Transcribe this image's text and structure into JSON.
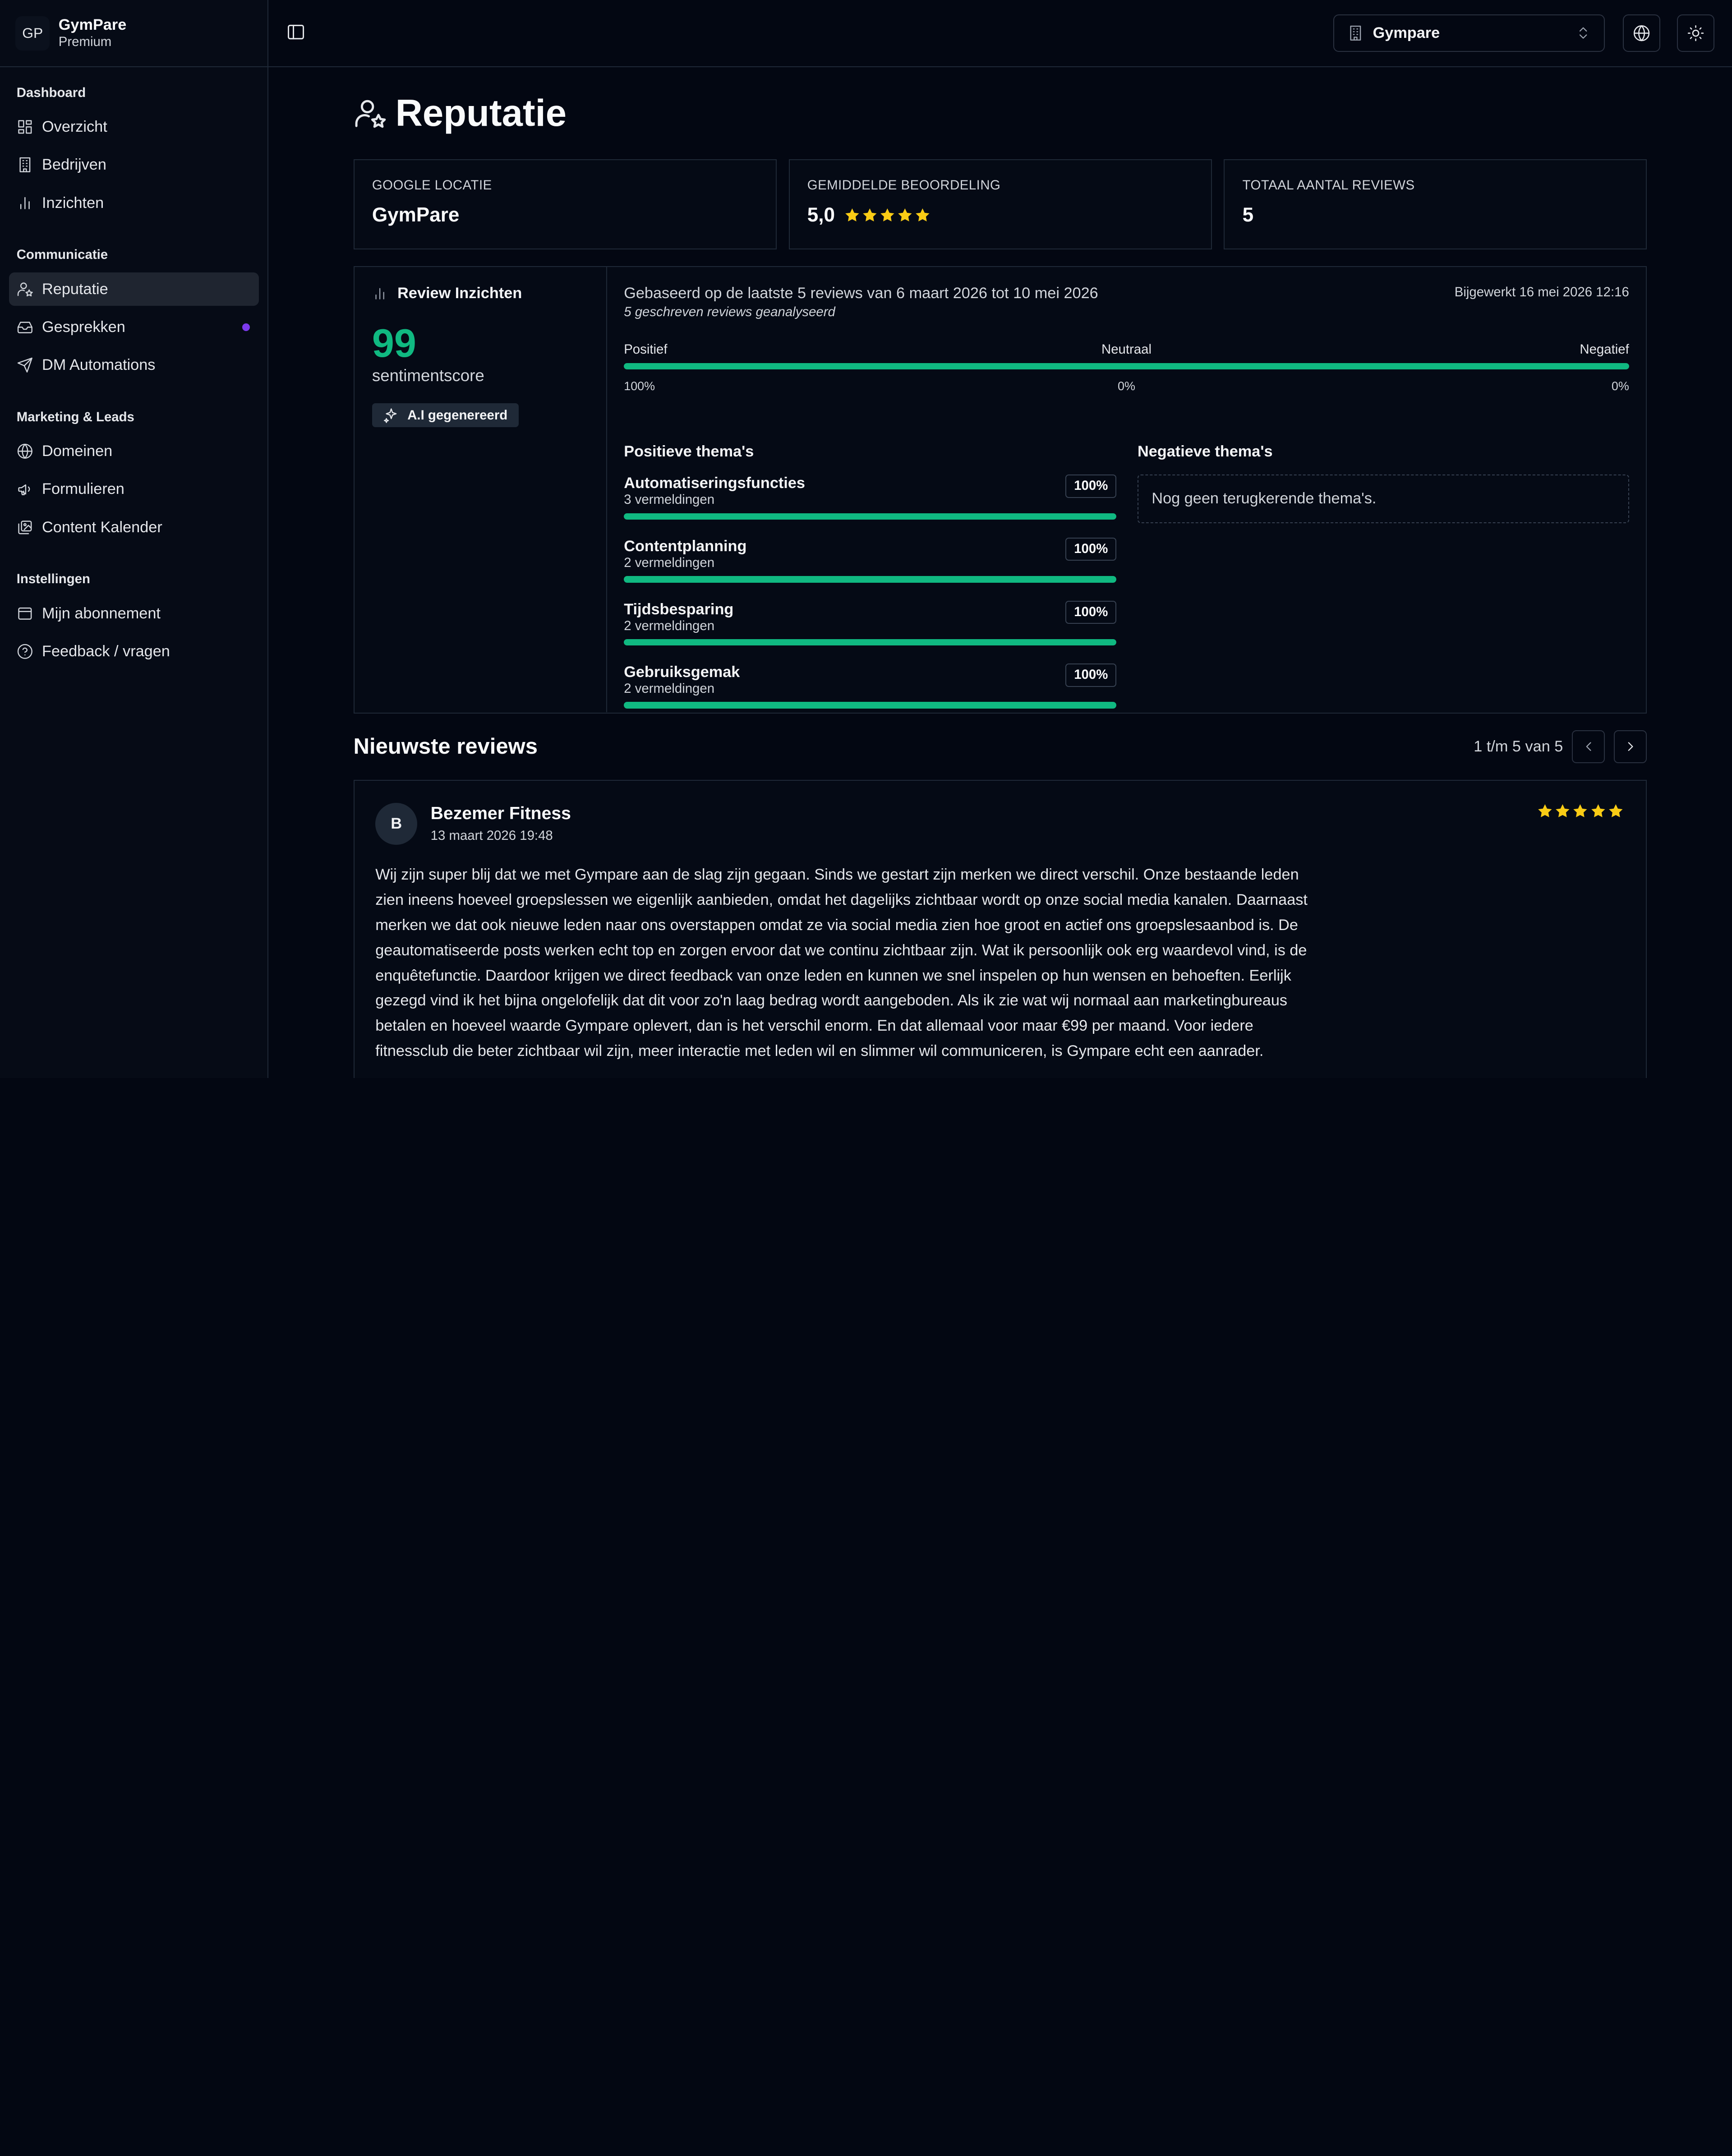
{
  "brand": {
    "logo": "GP",
    "name": "GymPare",
    "plan": "Premium"
  },
  "sidebar": {
    "groups": [
      {
        "title": "Dashboard",
        "items": [
          {
            "label": "Overzicht",
            "icon": "grid-icon"
          },
          {
            "label": "Bedrijven",
            "icon": "building-icon"
          },
          {
            "label": "Inzichten",
            "icon": "bar-chart-icon"
          }
        ]
      },
      {
        "title": "Communicatie",
        "items": [
          {
            "label": "Reputatie",
            "icon": "user-star-icon",
            "active": true
          },
          {
            "label": "Gesprekken",
            "icon": "inbox-icon",
            "badge_color": "#7c3aed"
          },
          {
            "label": "DM Automations",
            "icon": "send-icon"
          }
        ]
      },
      {
        "title": "Marketing & Leads",
        "items": [
          {
            "label": "Domeinen",
            "icon": "globe-icon"
          },
          {
            "label": "Formulieren",
            "icon": "megaphone-icon"
          },
          {
            "label": "Content Kalender",
            "icon": "images-icon"
          }
        ]
      },
      {
        "title": "Instellingen",
        "items": [
          {
            "label": "Mijn abonnement",
            "icon": "credit-card-icon"
          },
          {
            "label": "Feedback / vragen",
            "icon": "help-circle-icon"
          }
        ]
      }
    ]
  },
  "header": {
    "org_select": "Gympare"
  },
  "page": {
    "title": "Reputatie"
  },
  "stats": {
    "location_label": "GOOGLE LOCATIE",
    "location_value": "GymPare",
    "rating_label": "GEMIDDELDE BEOORDELING",
    "rating_value": "5,0",
    "rating_stars": 5,
    "total_label": "TOTAAL AANTAL REVIEWS",
    "total_value": "5"
  },
  "insights": {
    "title": "Review Inzichten",
    "score": "99",
    "score_label": "sentimentscore",
    "ai_badge": "A.I gegenereerd",
    "based_on": "Gebaseerd op de laatste 5 reviews van 6 maart 2026 tot 10 mei 2026",
    "analyzed": "5 geschreven reviews geanalyseerd",
    "updated": "Bijgewerkt 16 mei 2026 12:16",
    "sentiment": {
      "positive_label": "Positief",
      "neutral_label": "Neutraal",
      "negative_label": "Negatief",
      "positive_pct": "100%",
      "neutral_pct": "0%",
      "negative_pct": "0%",
      "positive_fraction": 1.0
    },
    "positive_title": "Positieve thema's",
    "positive_themes": [
      {
        "name": "Automatiseringsfuncties",
        "count": "3 vermeldingen",
        "pct": "100%",
        "fraction": 1.0
      },
      {
        "name": "Contentplanning",
        "count": "2 vermeldingen",
        "pct": "100%",
        "fraction": 1.0
      },
      {
        "name": "Tijdsbesparing",
        "count": "2 vermeldingen",
        "pct": "100%",
        "fraction": 1.0
      },
      {
        "name": "Gebruiksgemak",
        "count": "2 vermeldingen",
        "pct": "100%",
        "fraction": 1.0
      }
    ],
    "negative_title": "Negatieve thema's",
    "negative_empty": "Nog geen terugkerende thema's."
  },
  "reviews": {
    "title": "Nieuwste reviews",
    "pager": "1 t/m 5 van 5",
    "items": [
      {
        "initial": "B",
        "name": "Bezemer Fitness",
        "date": "13 maart 2026 19:48",
        "stars": 5,
        "text": "Wij zijn super blij dat we met Gympare aan de slag zijn gegaan. Sinds we gestart zijn merken we direct verschil. Onze bestaande leden zien ineens hoeveel groepslessen we eigenlijk aanbieden, omdat het dagelijks zichtbaar wordt op onze social media kanalen. Daarnaast merken we dat ook nieuwe leden naar ons overstappen omdat ze via social media zien hoe groot en actief ons groepslesaanbod is. De geautomatiseerde posts werken echt top en zorgen ervoor dat we continu zichtbaar zijn. Wat ik persoonlijk ook erg waardevol vind, is de enquêtefunctie. Daardoor krijgen we direct feedback van onze leden en kunnen we snel inspelen op hun wensen en behoeften. Eerlijk gezegd vind ik het bijna ongelofelijk dat dit voor zo'n laag bedrag wordt aangeboden. Als ik zie wat wij normaal aan marketingbureaus betalen en hoeveel waarde Gympare oplevert, dan is het verschil enorm. En dat allemaal voor maar €99 per maand. Voor iedere fitnessclub die beter zichtbaar wil zijn, meer interactie met leden wil en slimmer wil communiceren, is Gympare echt een aanrader."
      }
    ]
  },
  "colors": {
    "accent": "#10b981",
    "star": "#facc15",
    "badge": "#7c3aed",
    "background": "#030712"
  }
}
